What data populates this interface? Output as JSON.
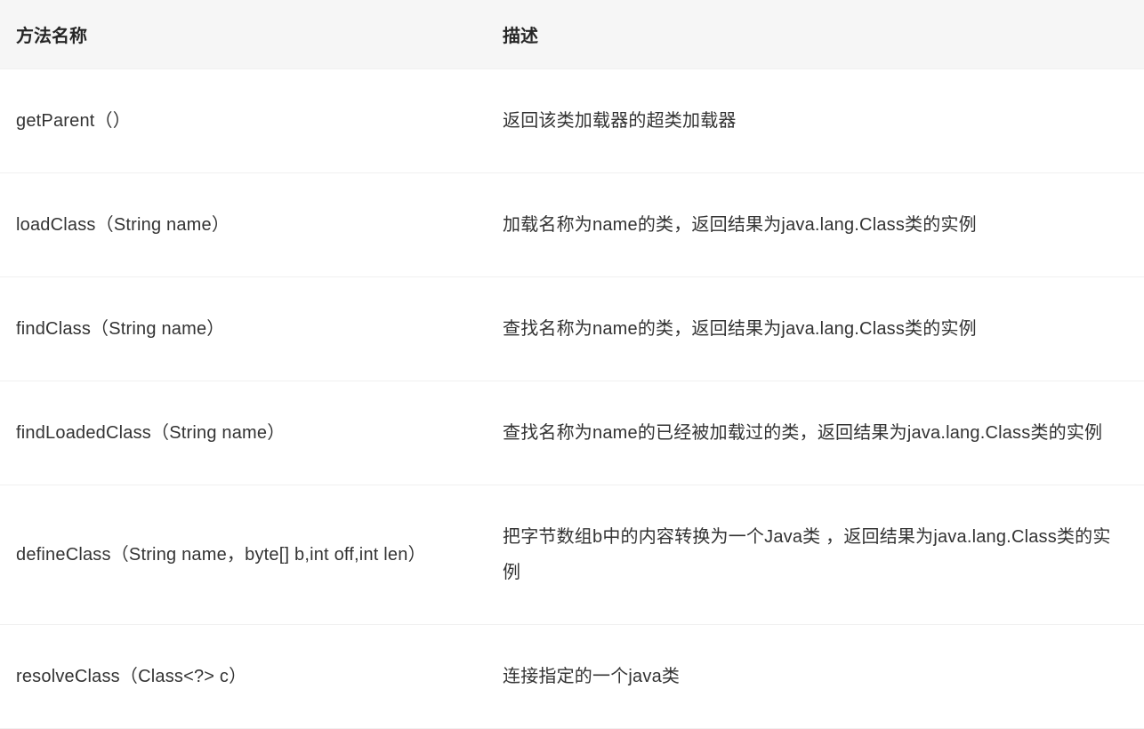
{
  "headers": {
    "method": "方法名称",
    "description": "描述"
  },
  "rows": [
    {
      "method": "getParent（）",
      "description": "返回该类加载器的超类加载器"
    },
    {
      "method": "loadClass（String name）",
      "description": "加载名称为name的类，返回结果为java.lang.Class类的实例"
    },
    {
      "method": "findClass（String name）",
      "description": "查找名称为name的类，返回结果为java.lang.Class类的实例"
    },
    {
      "method": "findLoadedClass（String name）",
      "description": "查找名称为name的已经被加载过的类，返回结果为java.lang.Class类的实例"
    },
    {
      "method": "defineClass（String name，byte[] b,int off,int len）",
      "description": "把字节数组b中的内容转换为一个Java类 ，返回结果为java.lang.Class类的实例"
    },
    {
      "method": "resolveClass（Class<?> c）",
      "description": "连接指定的一个java类"
    }
  ]
}
